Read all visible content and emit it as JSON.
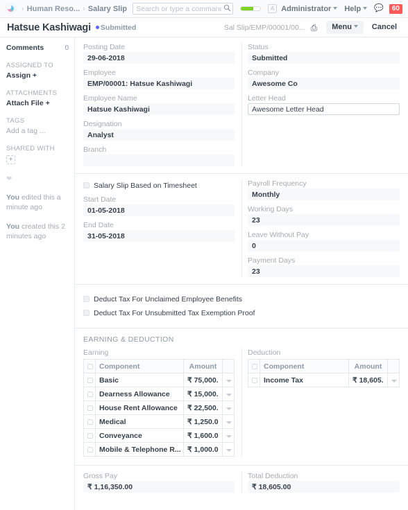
{
  "navbar": {
    "logo_icon": "frappe-logo-icon",
    "breadcrumbs": [
      {
        "label": "Human Reso...",
        "name": "breadcrumb-human-resources"
      },
      {
        "label": "Salary Slip",
        "name": "breadcrumb-salary-slip"
      }
    ],
    "search": {
      "placeholder": "Search or type a command (Ctrl + G)",
      "value": "",
      "icon": "search-icon"
    },
    "progress_percent": 62,
    "progress_color": "#7ed321",
    "avatar_letter": "A",
    "user_label": "Administrator",
    "help_label": "Help",
    "chat_icon": "chat-bubble-icon",
    "notification_count": "60",
    "notification_color": "#ff5858"
  },
  "titlebar": {
    "doc_title": "Hatsue Kashiwagi",
    "status_label": "Submitted",
    "status_dot_color": "#5e64ff",
    "doc_id": "Sal Slip/EMP/00001/00...",
    "print_icon": "printer-icon",
    "menu_label": "Menu",
    "cancel_label": "Cancel"
  },
  "sidebar": {
    "comments_label": "Comments",
    "comments_count": "0",
    "assigned_to_label": "ASSIGNED TO",
    "assign_action": "Assign +",
    "attachments_label": "ATTACHMENTS",
    "attach_action": "Attach File +",
    "tags_label": "TAGS",
    "tags_action": "Add a tag ...",
    "shared_with_label": "SHARED WITH",
    "share_icon": "add-share-icon",
    "like_icon": "heart-icon",
    "edit_log": "You edited this a minute ago",
    "edit_log_who": "You",
    "edit_log_rest": " edited this a minute ago",
    "create_log_who": "You",
    "create_log_rest": " created this 2 minutes ago"
  },
  "form": {
    "section1": {
      "left": [
        {
          "label": "Posting Date",
          "value": "29-06-2018",
          "name": "posting-date"
        },
        {
          "label": "Employee",
          "value": "EMP/00001: Hatsue Kashiwagi",
          "name": "employee"
        },
        {
          "label": "Employee Name",
          "value": "Hatsue Kashiwagi",
          "name": "employee-name"
        },
        {
          "label": "Designation",
          "value": "Analyst",
          "name": "designation"
        },
        {
          "label": "Branch",
          "value": "",
          "name": "branch"
        }
      ],
      "right": [
        {
          "label": "Status",
          "value": "Submitted",
          "name": "status"
        },
        {
          "label": "Company",
          "value": "Awesome Co",
          "name": "company"
        },
        {
          "label": "Letter Head",
          "value": "Awesome Letter Head",
          "name": "letter-head"
        }
      ]
    },
    "section2": {
      "timesheet_checkbox_label": "Salary Slip Based on Timesheet",
      "left": [
        {
          "label": "Start Date",
          "value": "01-05-2018",
          "name": "start-date"
        },
        {
          "label": "End Date",
          "value": "31-05-2018",
          "name": "end-date"
        }
      ],
      "right": [
        {
          "label": "Payroll Frequency",
          "value": "Monthly",
          "name": "payroll-frequency"
        },
        {
          "label": "Working Days",
          "value": "23",
          "name": "working-days"
        },
        {
          "label": "Leave Without Pay",
          "value": "0",
          "name": "leave-without-pay"
        },
        {
          "label": "Payment Days",
          "value": "23",
          "name": "payment-days"
        }
      ]
    },
    "section3": {
      "checkbox1": "Deduct Tax For Unclaimed Employee Benefits",
      "checkbox2": "Deduct Tax For Unsubmitted Tax Exemption Proof"
    },
    "section4": {
      "section_title": "EARNING & DEDUCTION",
      "earning": {
        "label": "Earning",
        "columns": [
          "Component",
          "Amount"
        ],
        "rows": [
          {
            "component": "Basic",
            "amount": "₹ 75,000."
          },
          {
            "component": "Dearness Allowance",
            "amount": "₹ 15,000."
          },
          {
            "component": "House Rent Allowance",
            "amount": "₹ 22,500."
          },
          {
            "component": "Medical",
            "amount": "₹ 1,250.0"
          },
          {
            "component": "Conveyance",
            "amount": "₹ 1,600.0"
          },
          {
            "component": "Mobile & Telephone R...",
            "amount": "₹ 1,000.0"
          }
        ]
      },
      "deduction": {
        "label": "Deduction",
        "columns": [
          "Component",
          "Amount"
        ],
        "rows": [
          {
            "component": "Income Tax",
            "amount": "₹ 18,605."
          }
        ]
      }
    },
    "section5": {
      "gross_pay_label": "Gross Pay",
      "gross_pay_value": "₹ 1,16,350.00",
      "total_deduction_label": "Total Deduction",
      "total_deduction_value": "₹ 18,605.00"
    }
  }
}
